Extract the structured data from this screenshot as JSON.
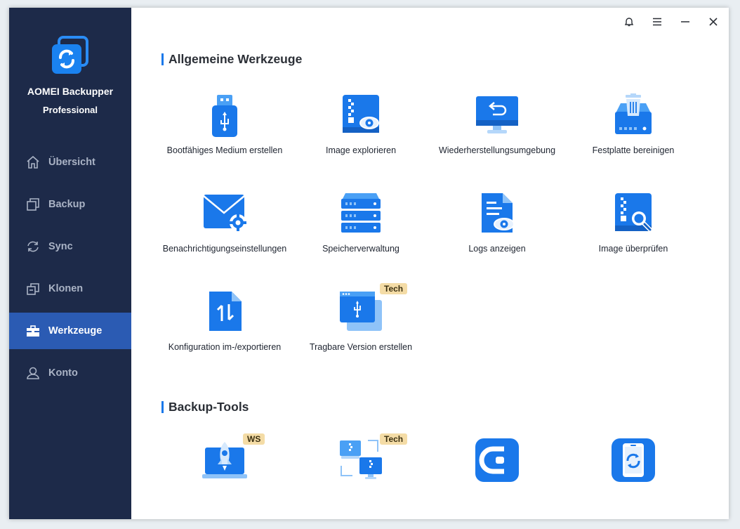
{
  "app": {
    "name": "AOMEI Backupper",
    "edition": "Professional"
  },
  "sidebar": {
    "items": [
      {
        "label": "Übersicht",
        "icon": "home-icon",
        "active": false
      },
      {
        "label": "Backup",
        "icon": "backup-icon",
        "active": false
      },
      {
        "label": "Sync",
        "icon": "sync-icon",
        "active": false
      },
      {
        "label": "Klonen",
        "icon": "clone-icon",
        "active": false
      },
      {
        "label": "Werkzeuge",
        "icon": "toolbox-icon",
        "active": true
      },
      {
        "label": "Konto",
        "icon": "user-icon",
        "active": false
      }
    ]
  },
  "titlebar": {
    "buttons": [
      "bell-icon",
      "menu-icon",
      "minimize-icon",
      "close-icon"
    ]
  },
  "sections": {
    "general": {
      "title": "Allgemeine Werkzeuge",
      "tools": [
        {
          "label": "Bootfähiges Medium erstellen",
          "icon": "usb-icon"
        },
        {
          "label": "Image explorieren",
          "icon": "image-explore-icon"
        },
        {
          "label": "Wiederherstellungsumgebung",
          "icon": "recovery-monitor-icon"
        },
        {
          "label": "Festplatte bereinigen",
          "icon": "disk-wipe-icon"
        },
        {
          "label": "Benachrichtigungseinstellungen",
          "icon": "mail-settings-icon"
        },
        {
          "label": "Speicherverwaltung",
          "icon": "storage-icon"
        },
        {
          "label": "Logs anzeigen",
          "icon": "logs-icon"
        },
        {
          "label": "Image überprüfen",
          "icon": "image-check-icon"
        },
        {
          "label": "Konfiguration im-/exportieren",
          "icon": "import-export-icon"
        },
        {
          "label": "Tragbare Version erstellen",
          "icon": "portable-icon",
          "badge": "Tech"
        }
      ]
    },
    "backup_tools": {
      "title": "Backup-Tools",
      "tools": [
        {
          "label": "",
          "icon": "rocket-laptop-icon",
          "badge": "WS"
        },
        {
          "label": "",
          "icon": "network-backup-icon",
          "badge": "Tech"
        },
        {
          "label": "",
          "icon": "cbackup-icon"
        },
        {
          "label": "",
          "icon": "phone-sync-icon"
        }
      ]
    }
  },
  "colors": {
    "sidebar_bg": "#1d2a49",
    "active_bg": "#2b5bb3",
    "accent": "#1a78ea",
    "badge_bg": "#f4dca6"
  }
}
